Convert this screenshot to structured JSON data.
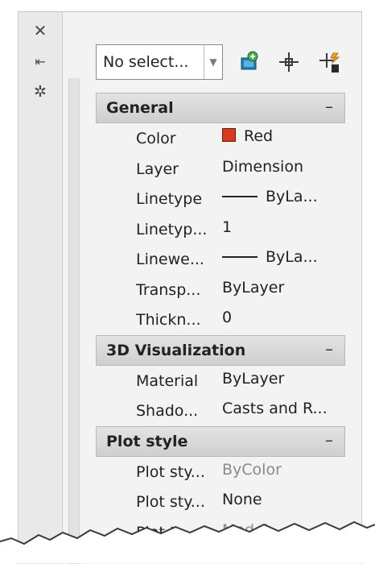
{
  "titlebar": {
    "buttons": [
      {
        "name": "close-icon",
        "glyph": "✕"
      },
      {
        "name": "autohide-icon",
        "glyph": "⇥"
      },
      {
        "name": "properties-menu-icon",
        "glyph": "✲"
      }
    ]
  },
  "toolbar": {
    "selection_value": "No select...",
    "buttons": [
      "toggle-pickadd-icon",
      "select-objects-icon",
      "quick-select-icon"
    ]
  },
  "categories": [
    {
      "title": "General",
      "collapse": "–",
      "rows": [
        {
          "name": "Color",
          "value": "Red",
          "swatch": "#d93a1c"
        },
        {
          "name": "Layer",
          "value": "Dimension"
        },
        {
          "name": "Linetype",
          "value": "ByLa...",
          "line": true,
          "line_width": 44
        },
        {
          "name": "Linetyp...",
          "value": "1"
        },
        {
          "name": "Linewe...",
          "value": "ByLa...",
          "line": true,
          "line_width": 44
        },
        {
          "name": "Transp...",
          "value": "ByLayer"
        },
        {
          "name": "Thickn...",
          "value": "0"
        }
      ]
    },
    {
      "title": "3D Visualization",
      "collapse": "–",
      "rows": [
        {
          "name": "Material",
          "value": "ByLayer"
        },
        {
          "name": "Shado...",
          "value": "Casts and R..."
        }
      ]
    },
    {
      "title": "Plot style",
      "collapse": "–",
      "rows": [
        {
          "name": "Plot sty...",
          "value": "ByColor",
          "muted": true
        },
        {
          "name": "Plot sty...",
          "value": "None"
        },
        {
          "name": "Plot ta...",
          "value": "Model",
          "muted": true
        }
      ]
    }
  ],
  "colors": {
    "panel": "#f3f3f3",
    "header": "#d6d6d6",
    "swatch_red": "#d93a1c"
  }
}
